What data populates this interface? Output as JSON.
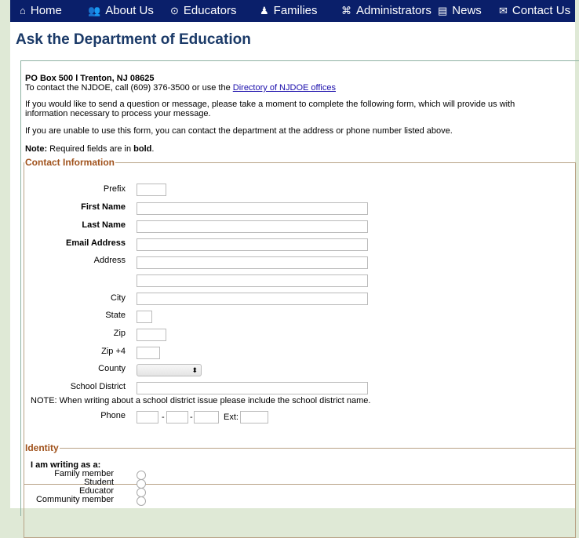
{
  "nav": [
    {
      "icon": "⌂",
      "label": "Home"
    },
    {
      "icon": "👥",
      "label": "About Us"
    },
    {
      "icon": "⊙",
      "label": "Educators"
    },
    {
      "icon": "♟",
      "label": "Families"
    },
    {
      "icon": "⌘",
      "label": "Administrators"
    },
    {
      "icon": "▤",
      "label": "News"
    },
    {
      "icon": "✉",
      "label": "Contact Us"
    }
  ],
  "page_title": "Ask the Department of Education",
  "address_line": "PO Box 500 l Trenton, NJ  08625",
  "contact_text": "To contact the NJDOE, call (609) 376-3500 or use the ",
  "contact_link": "Directory of NJDOE offices",
  "intro_1": "If you would like to send a question or message, please take a moment to complete the following form, which will provide us with",
  "intro_2": "information necessary to process your message.",
  "intro_3": "If you are unable to use this form, you can contact the department at the address or phone number listed above.",
  "note_label": "Note:",
  "note_text": " Required fields are in ",
  "note_bold": "bold",
  "note_end": ".",
  "contact_section": {
    "legend": "Contact Information",
    "prefix": "Prefix",
    "first_name": "First Name",
    "last_name": "Last Name",
    "email": "Email Address",
    "address": "Address",
    "city": "City",
    "state": "State",
    "zip": "Zip",
    "zip4": "Zip +4",
    "county": "County",
    "district": "School District",
    "district_note": "NOTE: When writing about a school district issue please include the school district name.",
    "phone": "Phone",
    "dash": "-",
    "ext": "Ext:"
  },
  "identity_section": {
    "legend": "Identity",
    "writing_as": "I am writing as a:",
    "options": [
      "Family member",
      "Student",
      "Educator",
      "Community member"
    ]
  }
}
